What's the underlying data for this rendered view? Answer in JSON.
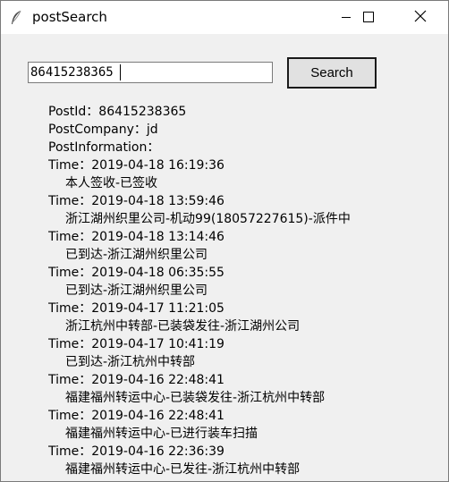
{
  "window": {
    "title": "postSearch"
  },
  "search": {
    "value": "86415238365",
    "button_label": "Search"
  },
  "result": {
    "post_id": "PostId：86415238365",
    "post_company": "PostCompany：jd",
    "post_information": "PostInformation：",
    "entries": [
      {
        "time": "Time：2019-04-18 16:19:36",
        "desc": "本人签收-已签收"
      },
      {
        "time": "Time：2019-04-18 13:59:46",
        "desc": "浙江湖州织里公司-机动99(18057227615)-派件中"
      },
      {
        "time": "Time：2019-04-18 13:14:46",
        "desc": "已到达-浙江湖州织里公司"
      },
      {
        "time": "Time：2019-04-18 06:35:55",
        "desc": "已到达-浙江湖州织里公司"
      },
      {
        "time": "Time：2019-04-17 11:21:05",
        "desc": "浙江杭州中转部-已装袋发往-浙江湖州公司"
      },
      {
        "time": "Time：2019-04-17 10:41:19",
        "desc": "已到达-浙江杭州中转部"
      },
      {
        "time": "Time：2019-04-16 22:48:41",
        "desc": "福建福州转运中心-已装袋发往-浙江杭州中转部"
      },
      {
        "time": "Time：2019-04-16 22:48:41",
        "desc": "福建福州转运中心-已进行装车扫描"
      },
      {
        "time": "Time：2019-04-16 22:36:39",
        "desc": "福建福州转运中心-已发往-浙江杭州中转部"
      }
    ]
  }
}
